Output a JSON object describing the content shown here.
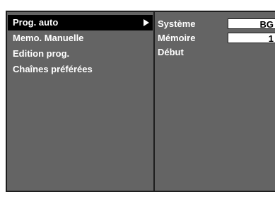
{
  "menu": {
    "items": [
      {
        "label": "Prog. auto"
      },
      {
        "label": "Memo. Manuelle"
      },
      {
        "label": "Edition prog."
      },
      {
        "label": "Chaînes préférées"
      }
    ],
    "selected_index": 0,
    "arrow_icon": "triangle-right-icon"
  },
  "settings": {
    "systeme": {
      "label": "Système",
      "value": "BG"
    },
    "memoire": {
      "label": "Mémoire",
      "value": "1"
    },
    "debut": {
      "label": "Début"
    }
  },
  "colors": {
    "panel": "#646464",
    "selection": "#000000",
    "text": "#ffffff",
    "border": "#1e1e1e",
    "value_box": "#ffffff"
  }
}
